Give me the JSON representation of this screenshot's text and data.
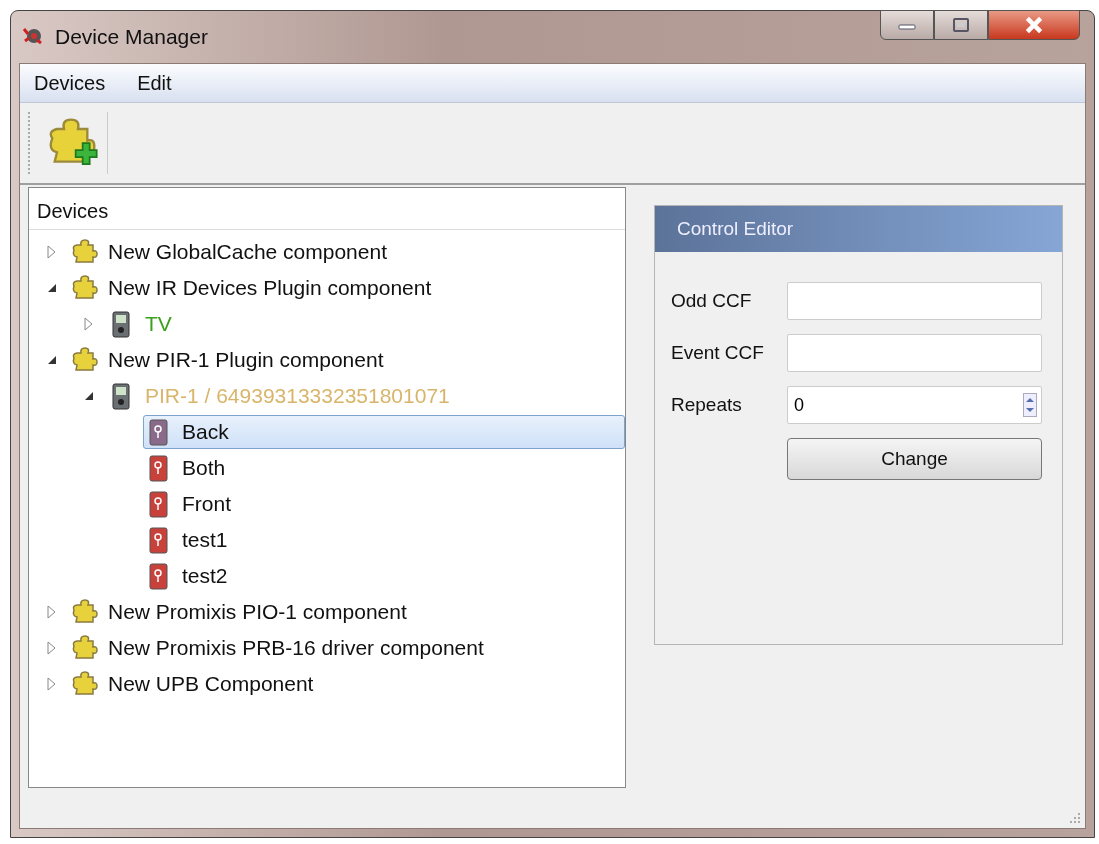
{
  "window": {
    "title": "Device Manager"
  },
  "menu": [
    {
      "label": "Devices"
    },
    {
      "label": "Edit"
    }
  ],
  "tree": {
    "header": "Devices",
    "items": [
      {
        "kind": "component",
        "label": "New GlobalCache component",
        "expanded": false,
        "selected": false
      },
      {
        "kind": "component",
        "label": "New IR Devices Plugin component",
        "expanded": true,
        "selected": false,
        "children": [
          {
            "kind": "device",
            "label": "TV",
            "color": "#3aa01e",
            "expanded": false,
            "selected": false
          }
        ]
      },
      {
        "kind": "component",
        "label": "New PIR-1 Plugin component",
        "expanded": true,
        "selected": false,
        "children": [
          {
            "kind": "device",
            "label": "PIR-1 / 64939313332351801071",
            "color": "#d8b56a",
            "expanded": true,
            "selected": false,
            "children": [
              {
                "kind": "control",
                "label": "Back",
                "selected": true
              },
              {
                "kind": "control",
                "label": "Both",
                "selected": false
              },
              {
                "kind": "control",
                "label": "Front",
                "selected": false
              },
              {
                "kind": "control",
                "label": "test1",
                "selected": false
              },
              {
                "kind": "control",
                "label": "test2",
                "selected": false
              }
            ]
          }
        ]
      },
      {
        "kind": "component",
        "label": "New Promixis PIO-1 component",
        "expanded": false,
        "selected": false
      },
      {
        "kind": "component",
        "label": "New Promixis PRB-16 driver component",
        "expanded": false,
        "selected": false
      },
      {
        "kind": "component",
        "label": "New UPB Component",
        "expanded": false,
        "selected": false
      }
    ]
  },
  "editor": {
    "title": "Control Editor",
    "fields": [
      {
        "kind": "text",
        "label": "Odd CCF"
      },
      {
        "kind": "text",
        "label": "Event CCF"
      },
      {
        "kind": "spin",
        "label": "Repeats",
        "value": "0"
      }
    ],
    "button": "Change"
  }
}
